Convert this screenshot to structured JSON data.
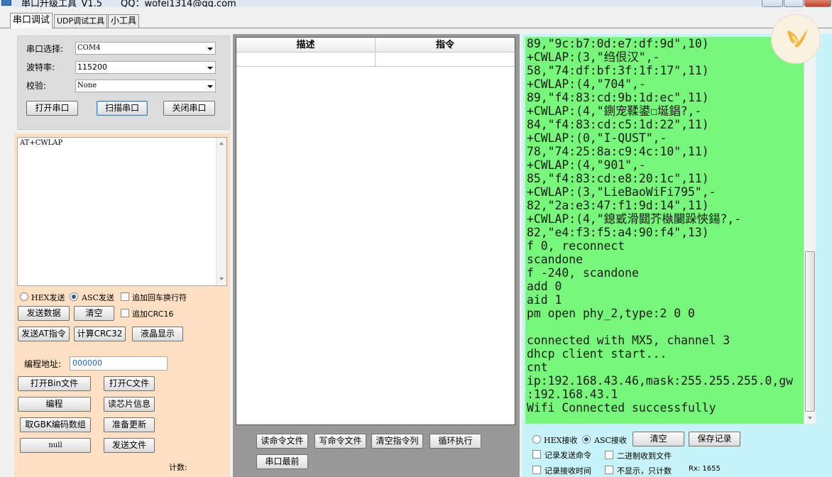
{
  "window": {
    "title": "串口升级工具_V1.5",
    "qq": "QQ：wofei1314@qq.com"
  },
  "tabs": [
    "串口调试",
    "UDP调试工具",
    "小工具"
  ],
  "config": {
    "port_label": "串口选择:",
    "port_value": "COM4",
    "baud_label": "波特率:",
    "baud_value": "115200",
    "parity_label": "校验:",
    "parity_value": "None",
    "open_btn": "打开串口",
    "scan_btn": "扫描串口",
    "close_btn": "关闭串口"
  },
  "send": {
    "text": "AT+CWLAP",
    "hex_label": "HEX发送",
    "asc_label": "ASC发送",
    "mode_selected": "ASC",
    "append_crlf_label": "追加回车换行符",
    "append_crlf_checked": false,
    "send_btn": "发送数据",
    "clear_btn": "清空",
    "append_crc_label": "追加CRC16",
    "append_crc_checked": false,
    "send_at_btn": "发送AT指令",
    "calc_crc_btn": "计算CRC32",
    "lcd_btn": "液晶显示"
  },
  "program": {
    "addr_label": "编程地址:",
    "addr_value": "000000",
    "open_bin_btn": "打开Bin文件",
    "open_c_btn": "打开C文件",
    "program_btn": "编程",
    "read_chip_btn": "读芯片信息",
    "gbk_btn": "取GBK编码数组",
    "prepare_update_btn": "准备更新",
    "null_btn": "null",
    "send_file_btn": "发送文件",
    "count_label": "计数:"
  },
  "cmd_table": {
    "headers": [
      "描述",
      "指令"
    ],
    "rows": [
      [
        "",
        ""
      ]
    ]
  },
  "cmd_buttons": {
    "read_cmd_file": "读命令文件",
    "write_cmd_file": "写命令文件",
    "clear_cmd_list": "清空指令列",
    "loop_exec": "循环执行",
    "serial_latest": "串口最前"
  },
  "receive": {
    "lines": [
      "89,\"9c:b7:0d:e7:df:9d\",10)",
      "+CWLAP:(3,\"绉佷汉\",-",
      "58,\"74:df:bf:3f:1f:17\",11)",
      "+CWLAP:(4,\"704\",-",
      "89,\"f4:83:cd:9b:1d:ec\",11)",
      "+CWLAP:(4,\"鍘宠鞣鍙☐埏錩?,-",
      "84,\"f4:83:cd:c5:1d:22\",11)",
      "+CWLAP:(0,\"I-QUST\",-",
      "78,\"74:25:8a:c9:4c:10\",11)",
      "+CWLAP:(4,\"901\",-",
      "85,\"f4:83:cd:e8:20:1c\",11)",
      "+CWLAP:(3,\"LieBaoWiFi795\",-",
      "82,\"2a:e3:47:f1:9d:14\",11)",
      "+CWLAP:(4,\"鎴戜滑閮芥槸闄跺悏鍚?,-",
      "82,\"e4:f3:f5:a4:90:f4\",13)",
      "f 0, reconnect",
      "scandone",
      "f -240, scandone",
      "add 0",
      "aid 1",
      "pm open phy_2,type:2 0 0",
      "",
      "connected with MX5, channel 3",
      "dhcp client start...",
      "cnt",
      "ip:192.168.43.46,mask:255.255.255.0,gw",
      ":192.168.43.1",
      "Wifi Connected successfully"
    ],
    "hex_label": "HEX接收",
    "asc_label": "ASC接收",
    "mode_selected": "ASC",
    "clear_btn": "清空",
    "save_btn": "保存记录",
    "log_send_label": "记录发送命令",
    "binary_file_label": "二进制收到文件",
    "log_recv_time_label": "记录接收时间",
    "hide_count_label": "不显示，只计数",
    "rx_label": "Rx: 1655"
  },
  "vip_badge": "VIP",
  "colors": {
    "receive_bg": "#77f87a",
    "right_panel_bg": "#c8f3f8",
    "left_panel_bg": "#ffe0c2",
    "middle_bg": "#999999"
  }
}
